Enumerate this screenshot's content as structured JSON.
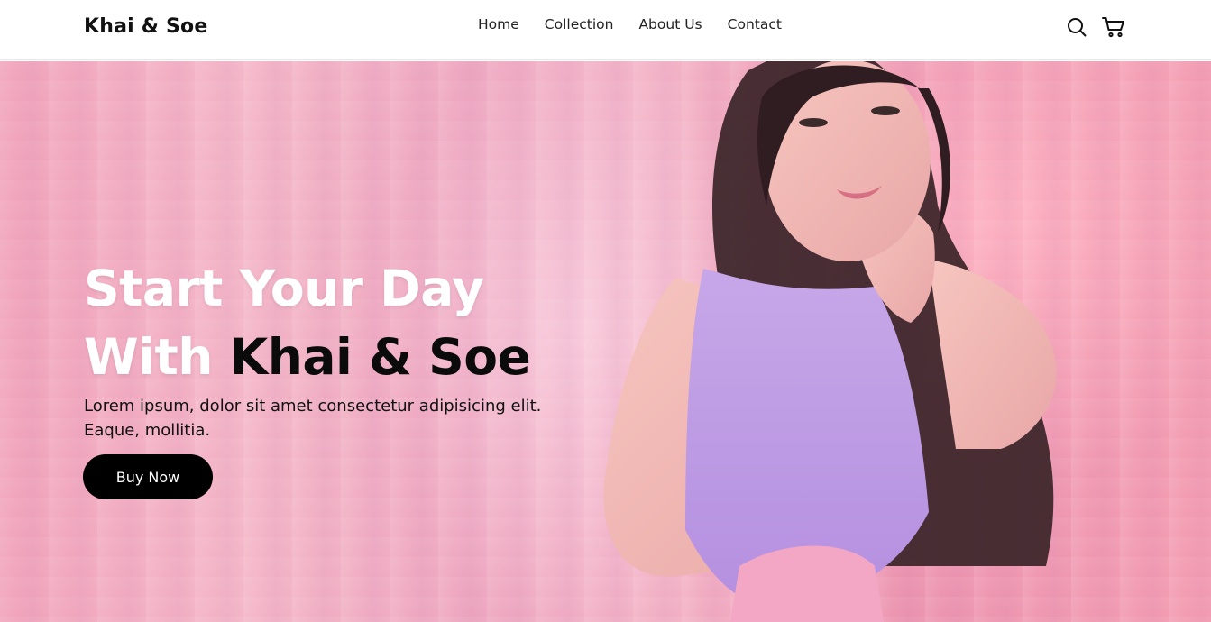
{
  "brand": {
    "name": "Khai & Soe"
  },
  "nav": {
    "links": [
      "Home",
      "Collection",
      "About Us",
      "Contact"
    ],
    "icons": [
      "search-icon",
      "cart-icon"
    ]
  },
  "hero": {
    "title_line1": "Start Your Day",
    "title_line2_prefix": "With ",
    "title_line2_brand": "Khai & Soe",
    "description": "Lorem ipsum, dolor sit amet consectetur adipisicing elit. Eaque, mollitia.",
    "cta_label": "Buy Now"
  },
  "colors": {
    "background_pink": "#f1a3bb",
    "button_bg": "#000000",
    "button_text": "#ffffff",
    "title_white": "#ffffff",
    "title_brand": "#0b0b0b"
  }
}
